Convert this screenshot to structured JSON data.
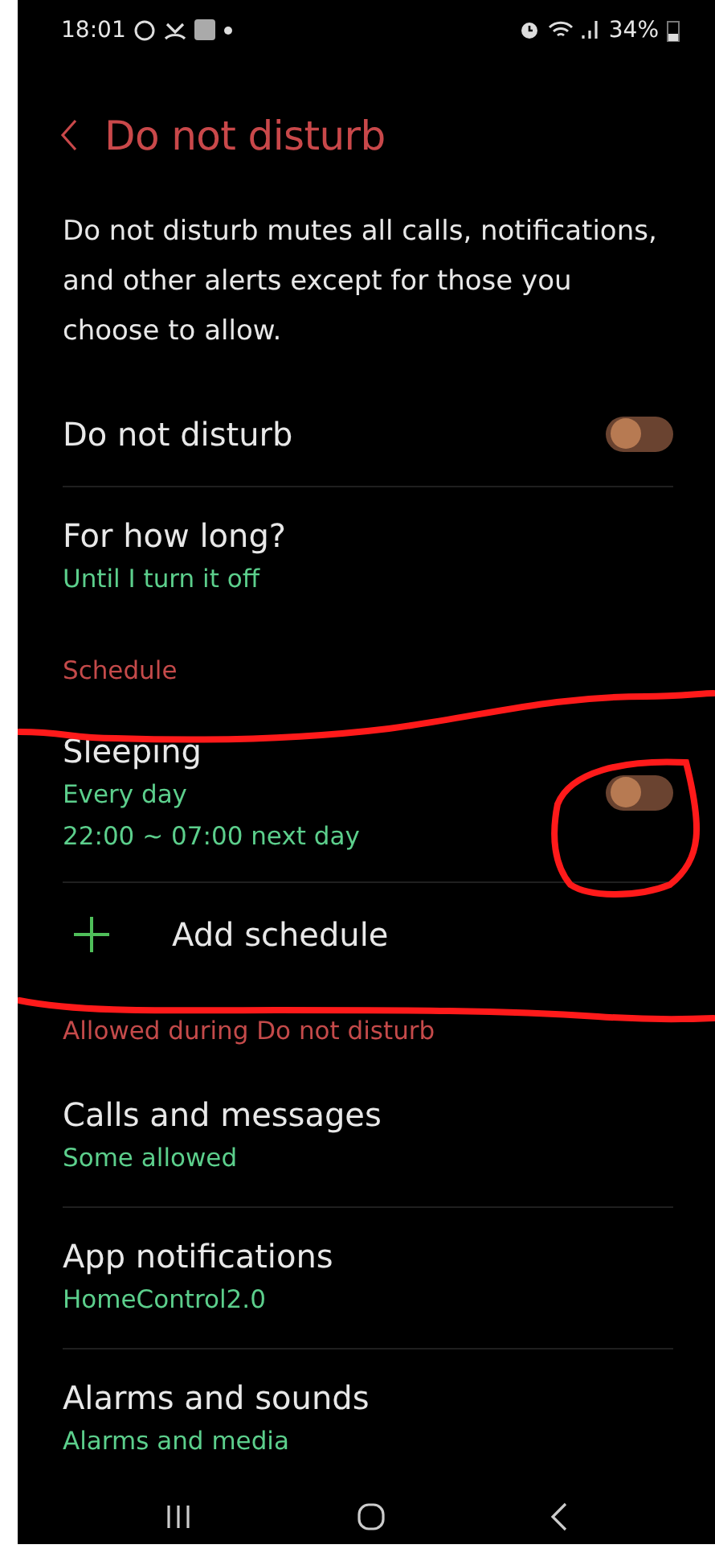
{
  "status_bar": {
    "time": "18:01",
    "battery": "34%"
  },
  "header": {
    "title": "Do not disturb"
  },
  "description": "Do not disturb mutes all calls, notifications, and other alerts except for those you choose to allow.",
  "sections": [
    {
      "items": [
        {
          "kind": "toggle",
          "title": "Do not disturb",
          "on": false
        },
        {
          "kind": "value",
          "title": "For how long?",
          "subtitle": "Until I turn it off"
        }
      ]
    },
    {
      "header": "Schedule",
      "items": [
        {
          "kind": "schedule",
          "title": "Sleeping",
          "lines": [
            "Every day",
            "22:00 ~ 07:00 next day"
          ],
          "on": false
        },
        {
          "kind": "add",
          "title": "Add schedule"
        }
      ]
    },
    {
      "header": "Allowed during Do not disturb",
      "items": [
        {
          "kind": "value",
          "title": "Calls and messages",
          "subtitle": "Some allowed"
        },
        {
          "kind": "value",
          "title": "App notifications",
          "subtitle": "HomeControl2.0"
        },
        {
          "kind": "value",
          "title": "Alarms and sounds",
          "subtitle": "Alarms and media"
        }
      ]
    }
  ]
}
